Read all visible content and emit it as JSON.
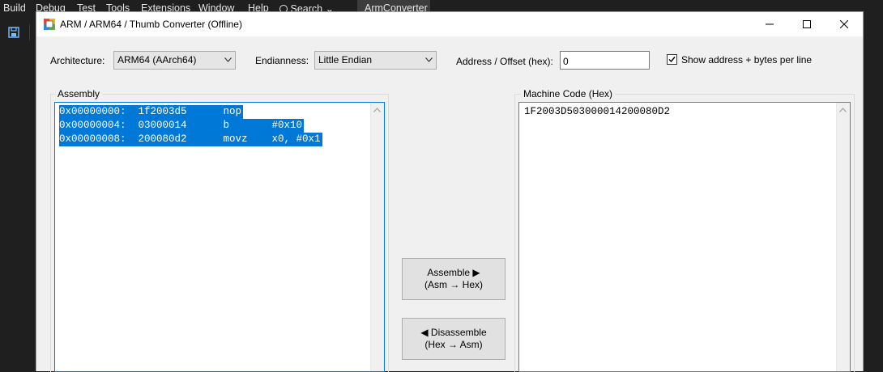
{
  "ide": {
    "menus": [
      "Build",
      "Debug",
      "Test",
      "Tools",
      "Extensions",
      "Window",
      "Help",
      "Search"
    ],
    "title_tab": "ArmConverter"
  },
  "dialog": {
    "title": "ARM / ARM64 / Thumb Converter (Offline)"
  },
  "options": {
    "architecture_label": "Architecture:",
    "architecture_value": "ARM64 (AArch64)",
    "endianness_label": "Endianness:",
    "endianness_value": "Little Endian",
    "address_label": "Address / Offset (hex):",
    "address_value": "0",
    "show_address_label": "Show address + bytes per line",
    "show_address_checked": true
  },
  "assembly": {
    "title": "Assembly",
    "lines": [
      "0x00000000:  1f2003d5      nop",
      "0x00000004:  03000014      b       #0x10",
      "0x00000008:  200080d2      movz    x0, #0x1"
    ]
  },
  "machine_code": {
    "title": "Machine Code (Hex)",
    "text": "1F2003D503000014200080D2"
  },
  "actions": {
    "assemble_line1": "Assemble ▶",
    "assemble_line2": "(Asm → Hex)",
    "disassemble_line1": "◀ Disassemble",
    "disassemble_line2": "(Hex → Asm)"
  },
  "colors": {
    "selection": "#0078d7",
    "dialog_bg": "#f0f0f0",
    "ide_bg": "#1f1f1f"
  }
}
